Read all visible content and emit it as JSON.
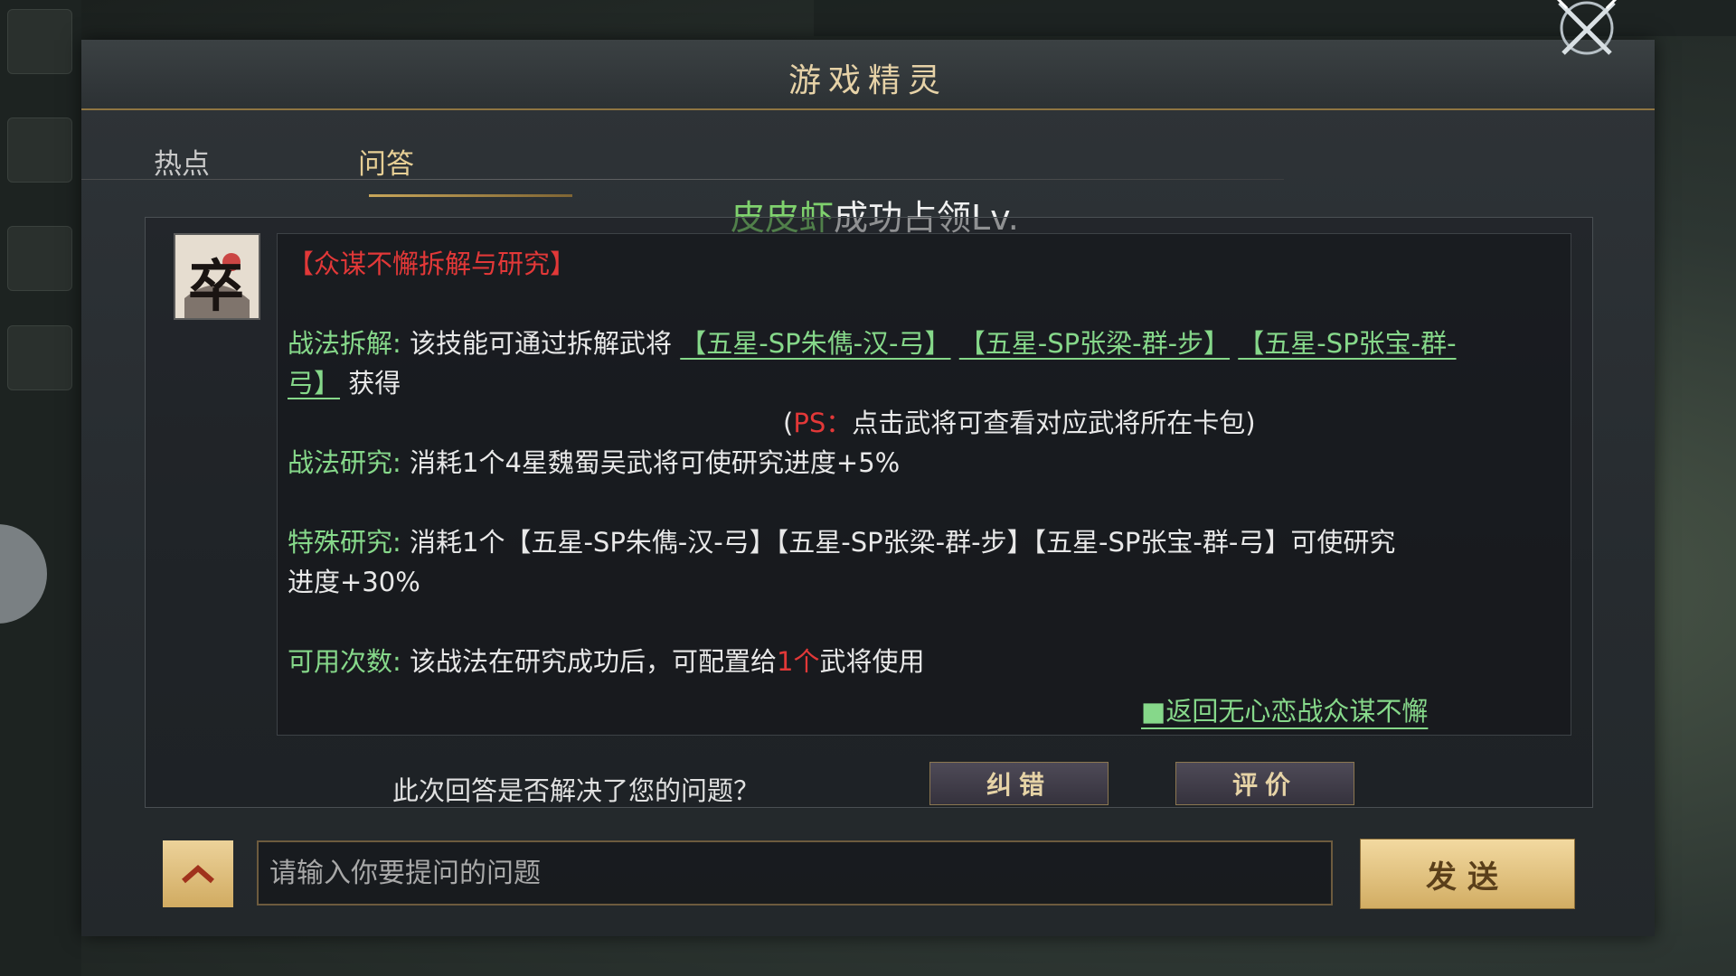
{
  "dialog": {
    "title": "游戏精灵",
    "close_icon": "crossed-swords-close-icon"
  },
  "tabs": [
    {
      "label": "热点",
      "active": false
    },
    {
      "label": "问答",
      "active": true
    }
  ],
  "banner": {
    "name": "皮皮虾",
    "text": "成功占领Lv."
  },
  "answer": {
    "avatar_char": "卒",
    "title": "【众谋不懈拆解与研究】",
    "split": {
      "label": "战法拆解:",
      "text": "该技能可通过拆解武将",
      "links": [
        "【五星-SP朱儁-汉-弓】",
        "【五星-SP张梁-群-步】",
        "【五星-SP张宝-群-"
      ],
      "link_cont": "弓】",
      "suffix": "获得"
    },
    "ps": {
      "open": "(",
      "label": "PS：",
      "text": "点击武将可查看对应武将所在卡包)"
    },
    "research": {
      "label": "战法研究:",
      "text": "消耗1个4星魏蜀吴武将可使研究进度+5%"
    },
    "special": {
      "label": "特殊研究:",
      "text_line1": "消耗1个【五星-SP朱儁-汉-弓】【五星-SP张梁-群-步】【五星-SP张宝-群-弓】可使研究",
      "text_line2": "进度+30%"
    },
    "uses": {
      "label": "可用次数:",
      "text_before": "该战法在研究成功后，可配置给",
      "highlight": "1个",
      "text_after": "武将使用"
    },
    "back_link": "■返回无心恋战众谋不懈"
  },
  "feedback": {
    "question": "此次回答是否解决了您的问题？",
    "correct_label": "纠错",
    "rate_label": "评价"
  },
  "input": {
    "placeholder": "请输入你要提问的问题",
    "value": "",
    "send_label": "发送",
    "up_icon": "chevron-up-icon"
  },
  "colors": {
    "accent_gold": "#e6d2a7",
    "link_green": "#86d88a",
    "highlight_red": "#e23838"
  }
}
